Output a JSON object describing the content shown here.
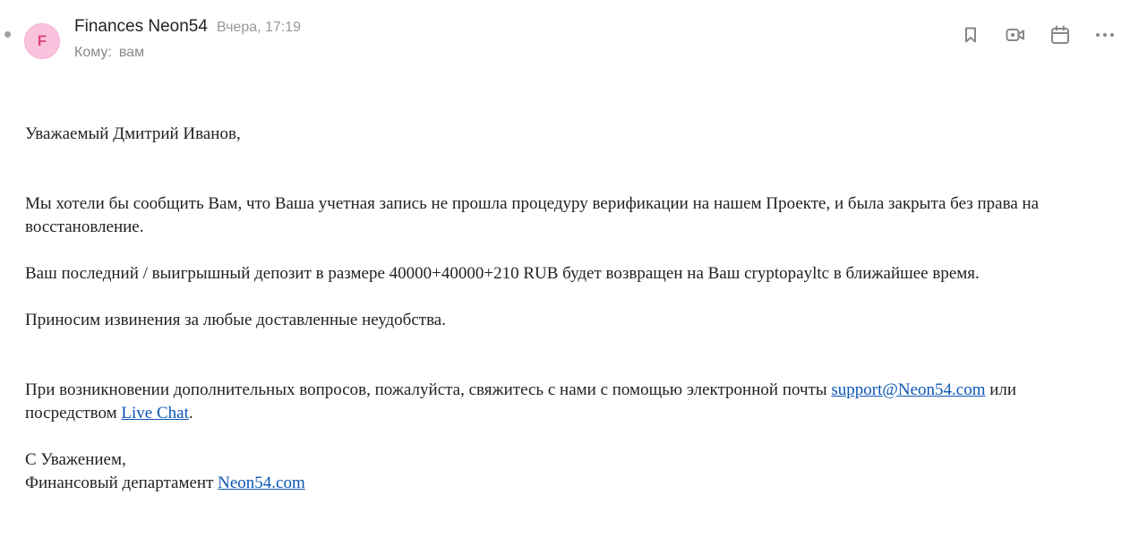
{
  "header": {
    "avatar_letter": "F",
    "sender": "Finances Neon54",
    "date": "Вчера, 17:19",
    "to_label": "Кому:",
    "to_value": "вам"
  },
  "actions": [
    {
      "icon": "bookmark-icon"
    },
    {
      "icon": "video-icon"
    },
    {
      "icon": "calendar-icon"
    },
    {
      "icon": "more-icon"
    }
  ],
  "colors": {
    "avatar_bg": "#fbc2dd",
    "avatar_letter": "#e0477f",
    "link": "#0d56b5"
  },
  "body": {
    "greeting": "Уважаемый Дмитрий Иванов,",
    "para1": "Мы хотели бы сообщить Вам, что Ваша учетная запись не прошла процедуру верификации на нашем Проекте, и была закрыта без права на восстановление.",
    "para2": "Ваш последний / выигрышный депозит в размере 40000+40000+210 RUB будет возвращен на Ваш cryptopayltc в ближайшее время.",
    "para3": "Приносим извинения за любые доставленные неудобства.",
    "para4_before": "При возникновении дополнительных вопросов, пожалуйста, свяжитесь с нами с помощью электронной почты ",
    "support_email": "support@Neon54.com",
    "para4_middle": " или посредством ",
    "live_chat": "Live Chat",
    "para4_end": ".",
    "sign1": "С Уважением,",
    "sign2_before": "Финансовый департамент ",
    "sign2_link": "Neon54.com"
  }
}
